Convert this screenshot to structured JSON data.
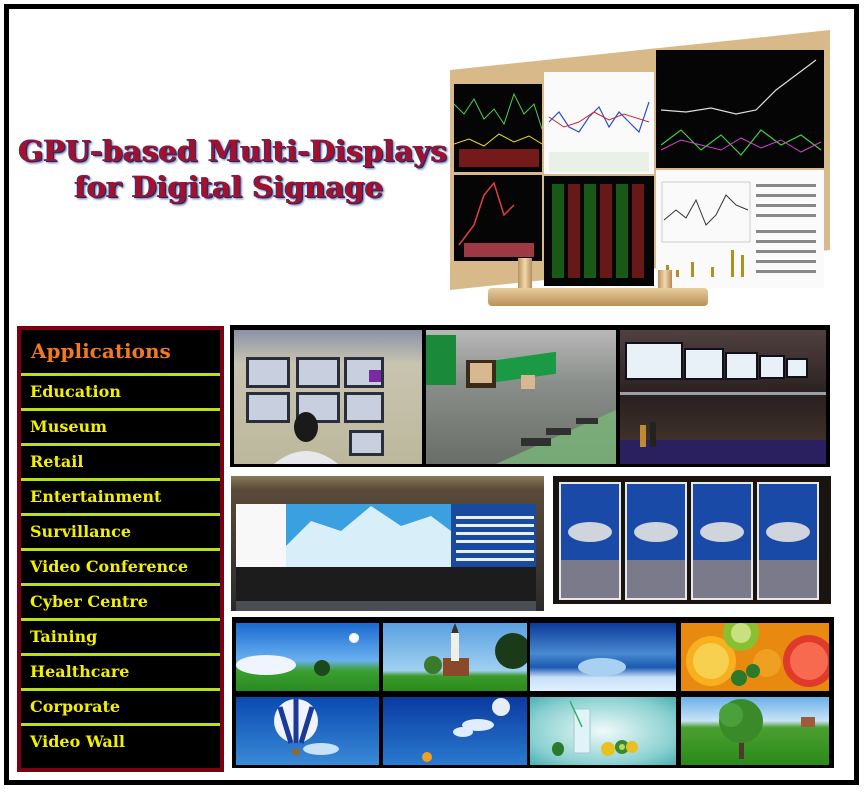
{
  "title": {
    "line1": "GPU-based  Multi-Displays",
    "line2": "for Digital Signage"
  },
  "applications": {
    "heading": "Applications",
    "items": [
      "Education",
      "Museum",
      "Retail",
      "Entertainment",
      "Survillance",
      "Video Conference",
      "Cyber Centre",
      "Taining",
      "Healthcare",
      "Corporate",
      "Video Wall"
    ]
  },
  "images": {
    "hero": "multi-display stock trading monitor wall",
    "row1": [
      "surveillance control room",
      "factory display screens",
      "restaurant menu boards"
    ],
    "row2": [
      "airport video wall",
      "vertical car advertisement displays"
    ],
    "row3": [
      "meadow with sun",
      "church on green lawn",
      "ice on blue background",
      "citrus and kiwi fruits",
      "hot air balloon in sky",
      "blue sky with balloon",
      "lemonade with kiwi",
      "tree on green field"
    ]
  },
  "colors": {
    "title_red": "#a8102a",
    "heading_orange": "#f07a20",
    "item_yellow": "#f2f000",
    "divider_green": "#b8e018",
    "sidebar_border": "#7a0012"
  }
}
